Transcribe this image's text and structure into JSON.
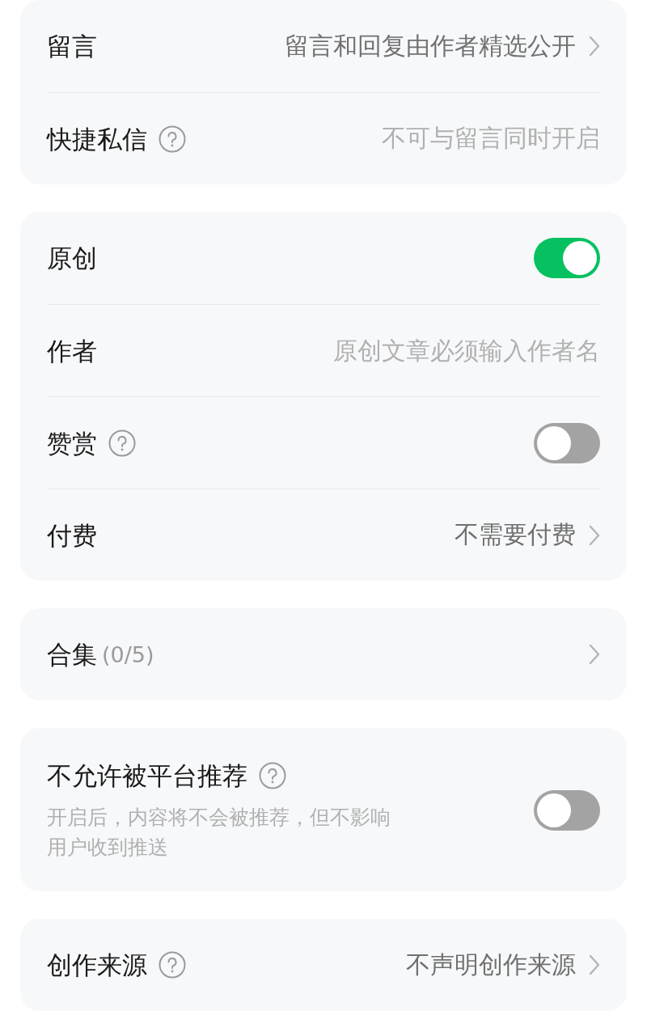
{
  "sections": [
    {
      "rows": [
        {
          "kind": "link",
          "label": "留言",
          "help": false,
          "value": "留言和回复由作者精选公开"
        },
        {
          "kind": "note",
          "label": "快捷私信",
          "help": true,
          "note": "不可与留言同时开启"
        }
      ]
    },
    {
      "rows": [
        {
          "kind": "switch",
          "label": "原创",
          "help": false,
          "on": true
        },
        {
          "kind": "input",
          "label": "作者",
          "help": false,
          "placeholder": "原创文章必须输入作者名"
        },
        {
          "kind": "switch",
          "label": "赞赏",
          "help": true,
          "on": false
        },
        {
          "kind": "link",
          "label": "付费",
          "help": false,
          "value": "不需要付费"
        }
      ]
    },
    {
      "rows": [
        {
          "kind": "link",
          "label": "合集",
          "help": false,
          "count": "(0/5)"
        }
      ]
    },
    {
      "rows": [
        {
          "kind": "switch",
          "label": "不允许被平台推荐",
          "help": true,
          "on": false,
          "description": "开启后，内容将不会被推荐，但不影响用户收到推送"
        }
      ]
    },
    {
      "rows": [
        {
          "kind": "link",
          "label": "创作来源",
          "help": true,
          "value": "不声明创作来源"
        }
      ]
    }
  ]
}
